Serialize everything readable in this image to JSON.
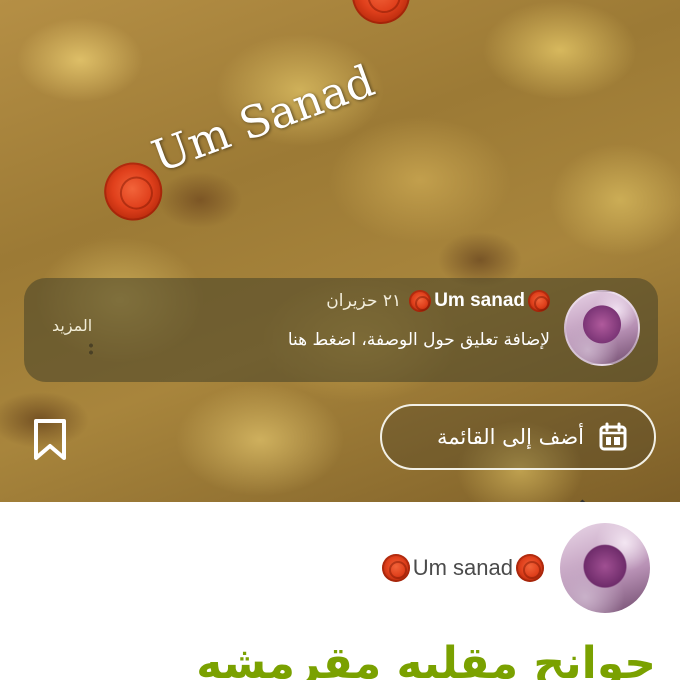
{
  "hero": {
    "watermark_text": "Um Sanad",
    "comment_card": {
      "author": "Um sanad",
      "date": "٢١ حزيران",
      "prompt": "لإضافة تعليق حول الوصفة، اضغط هنا",
      "more_label": "المزيد"
    },
    "add_to_list_label": "أضف إلى القائمة"
  },
  "author": {
    "name": "Um sanad"
  },
  "recipe": {
    "title": "جوانح مقليه مقرمشه"
  },
  "colors": {
    "title_green": "#7aa100",
    "rose_red": "#e0401c"
  }
}
